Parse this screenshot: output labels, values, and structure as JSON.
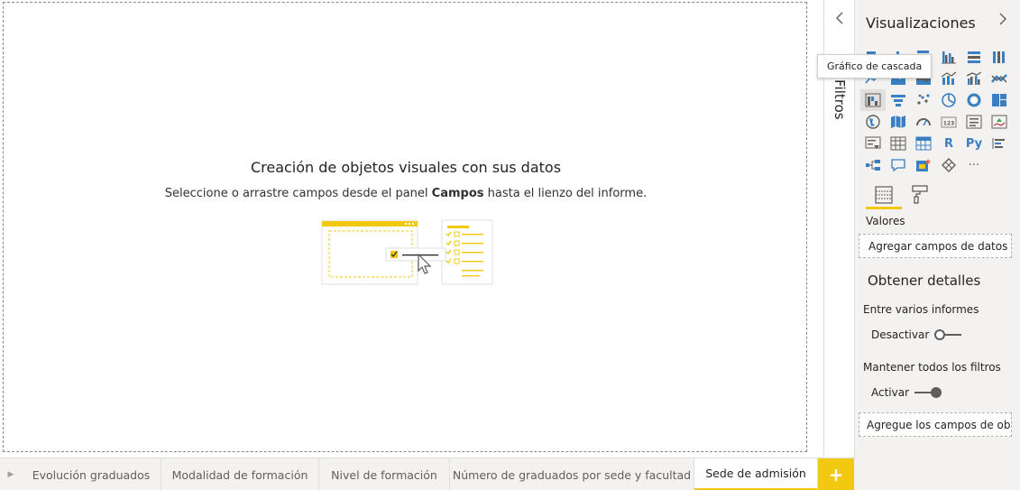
{
  "canvas": {
    "empty_title": "Creación de objetos visuales con sus datos",
    "empty_subtitle_before": "Seleccione o arrastre campos desde el panel ",
    "empty_subtitle_bold": "Campos",
    "empty_subtitle_after": " hasta el lienzo del informe."
  },
  "filters": {
    "label": "Filtros",
    "collapse_icon": "chevron-left-icon"
  },
  "visualizations": {
    "title": "Visualizaciones",
    "expand_icon": "chevron-right-icon",
    "tooltip": "Gráfico de cascada",
    "text_icons": {
      "r": "R",
      "py": "Py",
      "more": "···"
    },
    "tabs": [
      "fields-icon",
      "format-paint-icon"
    ],
    "values_label": "Valores",
    "values_placeholder": "Agregar campos de datos a...",
    "details_heading": "Obtener detalles",
    "cross_report_label": "Entre varios informes",
    "cross_report_state": "Desactivar",
    "keep_filters_label": "Mantener todos los filtros",
    "keep_filters_state": "Activar",
    "drillthrough_placeholder": "Agregue los campos de ob..."
  },
  "pages": {
    "tabs": [
      "Evolución graduados",
      "Modalidad de formación",
      "Nivel de formación",
      "Número de graduados por sede y facultad",
      "Sede de admisión"
    ],
    "active": "Sede de admisión",
    "add_label": "+"
  },
  "colors": {
    "accent": "#f2c811",
    "icon_blue": "#3a7fc1",
    "pane_bg": "#f3f2f1"
  }
}
